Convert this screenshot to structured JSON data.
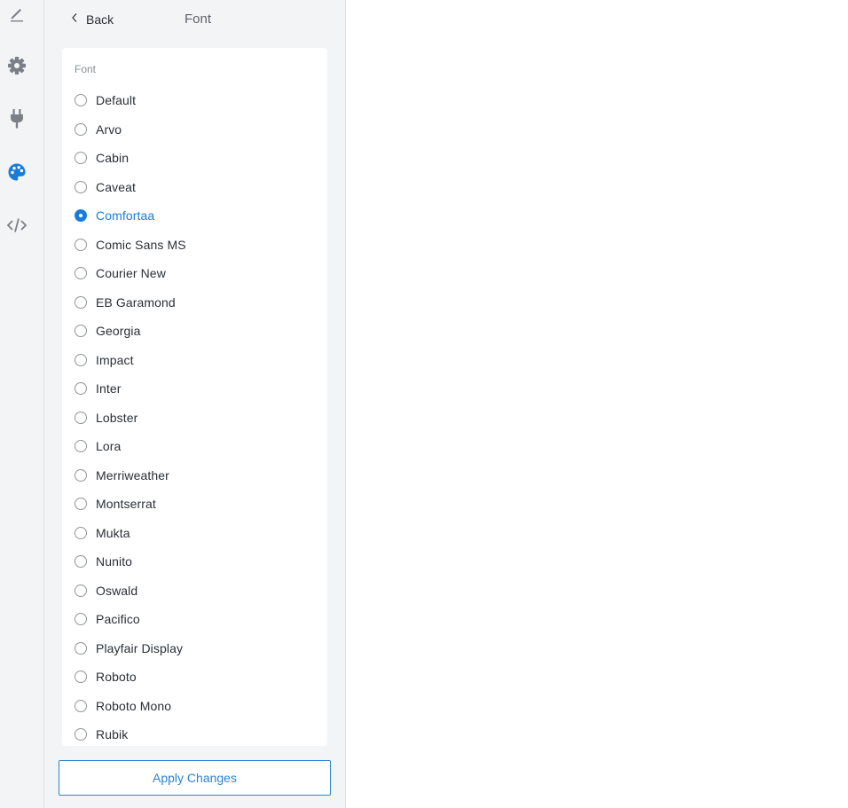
{
  "rail": {
    "items": [
      {
        "icon": "pencil-icon",
        "active": false
      },
      {
        "icon": "gear-icon",
        "active": false
      },
      {
        "icon": "plug-icon",
        "active": false
      },
      {
        "icon": "palette-icon",
        "active": true
      },
      {
        "icon": "code-icon",
        "active": false
      }
    ],
    "colors": {
      "icon": "#7b8088",
      "active": "#1a7cd9"
    }
  },
  "header": {
    "back_label": "Back",
    "title": "Font"
  },
  "font_picker": {
    "label": "Font",
    "selected": "Comfortaa",
    "options": [
      "Default",
      "Arvo",
      "Cabin",
      "Caveat",
      "Comfortaa",
      "Comic Sans MS",
      "Courier New",
      "EB Garamond",
      "Georgia",
      "Impact",
      "Inter",
      "Lobster",
      "Lora",
      "Merriweather",
      "Montserrat",
      "Mukta",
      "Nunito",
      "Oswald",
      "Pacifico",
      "Playfair Display",
      "Roboto",
      "Roboto Mono",
      "Rubik"
    ]
  },
  "footer": {
    "apply_label": "Apply Changes"
  }
}
